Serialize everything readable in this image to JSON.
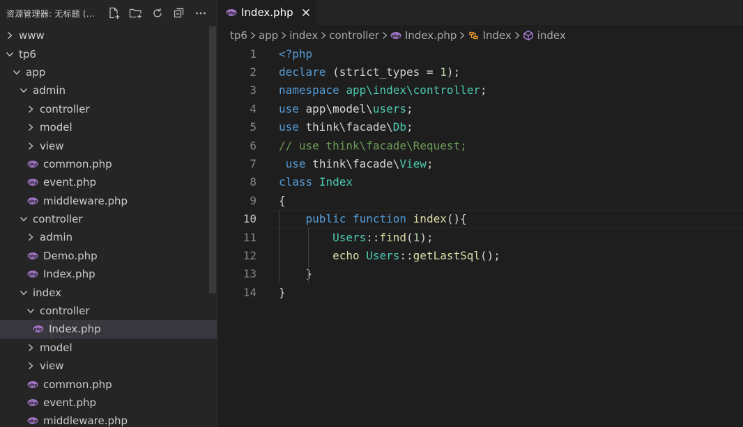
{
  "sidebar": {
    "title": "资源管理器: 无标题 (...",
    "actions": [
      "new-file-icon",
      "new-folder-icon",
      "refresh-icon",
      "collapse-all-icon",
      "more-icon"
    ],
    "tree": [
      {
        "label": "www",
        "type": "folder",
        "depth": 0,
        "expanded": false
      },
      {
        "label": "tp6",
        "type": "folder",
        "depth": 0,
        "expanded": true
      },
      {
        "label": "app",
        "type": "folder",
        "depth": 1,
        "expanded": true
      },
      {
        "label": "admin",
        "type": "folder",
        "depth": 2,
        "expanded": true
      },
      {
        "label": "controller",
        "type": "folder",
        "depth": 3,
        "expanded": false
      },
      {
        "label": "model",
        "type": "folder",
        "depth": 3,
        "expanded": false
      },
      {
        "label": "view",
        "type": "folder",
        "depth": 3,
        "expanded": false
      },
      {
        "label": "common.php",
        "type": "php",
        "depth": 3
      },
      {
        "label": "event.php",
        "type": "php",
        "depth": 3
      },
      {
        "label": "middleware.php",
        "type": "php",
        "depth": 3
      },
      {
        "label": "controller",
        "type": "folder",
        "depth": 2,
        "expanded": true
      },
      {
        "label": "admin",
        "type": "folder",
        "depth": 3,
        "expanded": false
      },
      {
        "label": "Demo.php",
        "type": "php",
        "depth": 3
      },
      {
        "label": "Index.php",
        "type": "php",
        "depth": 3
      },
      {
        "label": "index",
        "type": "folder",
        "depth": 2,
        "expanded": true
      },
      {
        "label": "controller",
        "type": "folder",
        "depth": 3,
        "expanded": true
      },
      {
        "label": "Index.php",
        "type": "php",
        "depth": 4,
        "selected": true
      },
      {
        "label": "model",
        "type": "folder",
        "depth": 3,
        "expanded": false
      },
      {
        "label": "view",
        "type": "folder",
        "depth": 3,
        "expanded": false
      },
      {
        "label": "common.php",
        "type": "php",
        "depth": 3
      },
      {
        "label": "event.php",
        "type": "php",
        "depth": 3
      },
      {
        "label": "middleware.php",
        "type": "php",
        "depth": 3
      }
    ]
  },
  "tab": {
    "label": "Index.php",
    "icon": "php-icon",
    "close_icon": "close-icon"
  },
  "breadcrumbs": [
    {
      "label": "tp6",
      "icon": ""
    },
    {
      "label": "app",
      "icon": ""
    },
    {
      "label": "index",
      "icon": ""
    },
    {
      "label": "controller",
      "icon": ""
    },
    {
      "label": "Index.php",
      "icon": "php-icon"
    },
    {
      "label": "Index",
      "icon": "class-icon"
    },
    {
      "label": "index",
      "icon": "method-icon"
    }
  ],
  "editor": {
    "current_line": 10,
    "lines": [
      {
        "n": "1",
        "tokens": [
          [
            "kw",
            "<?php"
          ]
        ]
      },
      {
        "n": "2",
        "tokens": [
          [
            "kw",
            "declare"
          ],
          [
            "pl",
            " (strict_types = "
          ],
          [
            "num",
            "1"
          ],
          [
            "pl",
            ");"
          ]
        ]
      },
      {
        "n": "3",
        "tokens": [
          [
            "kw",
            "namespace"
          ],
          [
            "pl",
            " "
          ],
          [
            "ty",
            "app\\index\\controller"
          ],
          [
            "pl",
            ";"
          ]
        ]
      },
      {
        "n": "4",
        "tokens": [
          [
            "kw",
            "use"
          ],
          [
            "pl",
            " app\\model\\"
          ],
          [
            "ty",
            "users"
          ],
          [
            "pl",
            ";"
          ]
        ]
      },
      {
        "n": "5",
        "tokens": [
          [
            "kw",
            "use"
          ],
          [
            "pl",
            " think\\facade\\"
          ],
          [
            "ty",
            "Db"
          ],
          [
            "pl",
            ";"
          ]
        ]
      },
      {
        "n": "6",
        "tokens": [
          [
            "cm",
            "// use think\\facade\\Request;"
          ]
        ]
      },
      {
        "n": "7",
        "tokens": [
          [
            "pl",
            " "
          ],
          [
            "kw",
            "use"
          ],
          [
            "pl",
            " think\\facade\\"
          ],
          [
            "ty",
            "View"
          ],
          [
            "pl",
            ";"
          ]
        ]
      },
      {
        "n": "8",
        "tokens": [
          [
            "kw",
            "class"
          ],
          [
            "pl",
            " "
          ],
          [
            "ty",
            "Index"
          ]
        ]
      },
      {
        "n": "9",
        "tokens": [
          [
            "pl",
            "{"
          ]
        ]
      },
      {
        "n": "10",
        "tokens": [
          [
            "pl",
            "    "
          ],
          [
            "kw",
            "public"
          ],
          [
            "pl",
            " "
          ],
          [
            "kw",
            "function"
          ],
          [
            "pl",
            " "
          ],
          [
            "fn",
            "index"
          ],
          [
            "pl",
            "(){"
          ]
        ]
      },
      {
        "n": "11",
        "tokens": [
          [
            "pl",
            "        "
          ],
          [
            "ty",
            "Users"
          ],
          [
            "pl",
            "::"
          ],
          [
            "fn",
            "find"
          ],
          [
            "pl",
            "("
          ],
          [
            "num",
            "1"
          ],
          [
            "pl",
            ");"
          ]
        ]
      },
      {
        "n": "12",
        "tokens": [
          [
            "pl",
            "        "
          ],
          [
            "fn",
            "echo"
          ],
          [
            "pl",
            " "
          ],
          [
            "ty",
            "Users"
          ],
          [
            "pl",
            "::"
          ],
          [
            "fn",
            "getLastSql"
          ],
          [
            "pl",
            "();"
          ]
        ]
      },
      {
        "n": "13",
        "tokens": [
          [
            "pl",
            "    }"
          ]
        ]
      },
      {
        "n": "14",
        "tokens": [
          [
            "pl",
            "}"
          ]
        ]
      }
    ]
  },
  "colors": {
    "php_icon": "#a074c4",
    "keyword": "#569cd6",
    "type": "#4ec9b0",
    "function": "#dcdcaa",
    "number": "#b5cea8",
    "comment": "#6a9955",
    "class_icon": "#ee9d28",
    "method_icon": "#b180d7"
  }
}
